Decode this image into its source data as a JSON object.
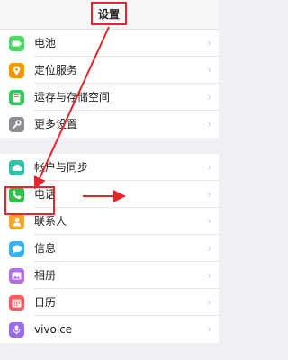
{
  "header": {
    "title": "设置"
  },
  "group1": [
    {
      "label": "电池",
      "icon": "battery-icon",
      "color": "#4cd964"
    },
    {
      "label": "定位服务",
      "icon": "location-icon",
      "color": "#ff9500"
    },
    {
      "label": "运存与存储空间",
      "icon": "storage-icon",
      "color": "#34c759"
    },
    {
      "label": "更多设置",
      "icon": "wrench-icon",
      "color": "#8e8e93"
    }
  ],
  "group2": [
    {
      "label": "帐户与同步",
      "icon": "cloud-sync-icon",
      "color": "#2ec4a6"
    },
    {
      "label": "电话",
      "icon": "phone-icon",
      "color": "#30c04a"
    },
    {
      "label": "联系人",
      "icon": "contacts-icon",
      "color": "#f5a623"
    },
    {
      "label": "信息",
      "icon": "message-icon",
      "color": "#34b4f5"
    },
    {
      "label": "相册",
      "icon": "album-icon",
      "color": "#b36ef0"
    },
    {
      "label": "日历",
      "icon": "calendar-icon",
      "color": "#ff5a5f"
    },
    {
      "label": "vivoice",
      "icon": "mic-icon",
      "color": "#9b6cf2"
    }
  ],
  "chevron": "›",
  "annotation_color": "#e3262b"
}
